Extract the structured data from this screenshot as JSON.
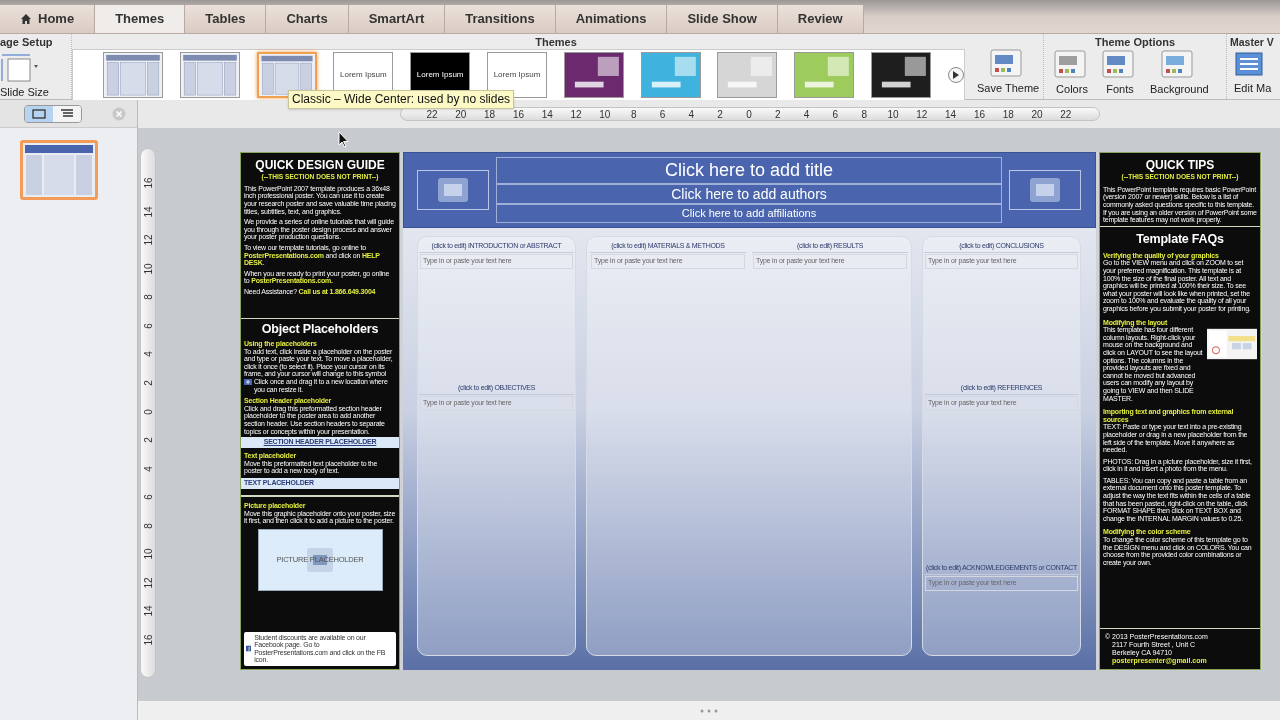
{
  "tabs": [
    {
      "label": "Home",
      "kind": "home",
      "selected": false
    },
    {
      "label": "Themes",
      "kind": "text",
      "selected": true
    },
    {
      "label": "Tables",
      "kind": "text",
      "selected": false
    },
    {
      "label": "Charts",
      "kind": "text",
      "selected": false
    },
    {
      "label": "SmartArt",
      "kind": "text",
      "selected": false
    },
    {
      "label": "Transitions",
      "kind": "text",
      "selected": false
    },
    {
      "label": "Animations",
      "kind": "text",
      "selected": false
    },
    {
      "label": "Slide Show",
      "kind": "text",
      "selected": false
    },
    {
      "label": "Review",
      "kind": "text",
      "selected": false
    }
  ],
  "ribbon": {
    "page_setup": {
      "label": "age Setup",
      "button": "Slide Size"
    },
    "themes": {
      "label": "Themes",
      "thumbnails": [
        {
          "kind": "layout",
          "selected": false
        },
        {
          "kind": "layout",
          "selected": false
        },
        {
          "kind": "layout",
          "selected": true
        },
        {
          "kind": "text",
          "label": "Lorem Ipsum",
          "dark": false,
          "selected": false
        },
        {
          "kind": "text",
          "label": "Lorem Ipsum",
          "dark": true,
          "selected": false
        },
        {
          "kind": "text",
          "label": "Lorem Ipsum",
          "dark": false,
          "selected": false
        },
        {
          "kind": "design",
          "color": "#6b2a6e",
          "selected": false
        },
        {
          "kind": "design",
          "color": "#3fb3dd",
          "selected": false
        },
        {
          "kind": "design",
          "color": "#d6d6d6",
          "selected": false
        },
        {
          "kind": "design",
          "color": "#9dcc5c",
          "selected": false
        },
        {
          "kind": "design",
          "color": "#1e1e1e",
          "selected": false
        }
      ],
      "save": "Save Theme"
    },
    "theme_options": {
      "label": "Theme Options",
      "buttons": [
        "Colors",
        "Fonts",
        "Background"
      ]
    },
    "master_views": {
      "label": "Master V",
      "button": "Edit Ma"
    }
  },
  "tooltip": "Classic – Wide Center: used by no slides",
  "view_modes": [
    {
      "kind": "slides",
      "selected": true
    },
    {
      "kind": "outline",
      "selected": false
    }
  ],
  "slide_thumbnails": [
    {
      "selected": true
    }
  ],
  "ruler_h": [
    "22",
    "20",
    "18",
    "16",
    "14",
    "12",
    "10",
    "8",
    "6",
    "4",
    "2",
    "0",
    "2",
    "4",
    "6",
    "8",
    "10",
    "12",
    "14",
    "16",
    "18",
    "20",
    "22"
  ],
  "ruler_v": [
    "16",
    "14",
    "12",
    "10",
    "8",
    "6",
    "4",
    "2",
    "0",
    "2",
    "4",
    "6",
    "8",
    "10",
    "12",
    "14",
    "16"
  ],
  "guide": {
    "title": "QUICK DESIGN GUIDE",
    "subtitle": "(--THIS SECTION DOES NOT PRINT--)",
    "paragraphs": [
      "This PowerPoint 2007 template produces a 36x48 inch professional  poster. You can use it to create your research poster and save valuable time placing titles, subtitles, text, and graphics.",
      "We provide a series of online tutorials that will guide you through the poster design process and answer your poster production questions.",
      "To view our template tutorials, go online to **PosterPresentations.com** and click on **HELP DESK**.",
      "When you are ready to  print your poster, go online to **PosterPresentations.com.**",
      "Need Assistance?  **Call  us at 1.866.649.3004**"
    ],
    "placeholders_title": "Object Placeholders",
    "placeholders": [
      {
        "kind": "cursor",
        "heading": "Using the placeholders",
        "text": "To add text, click inside a placeholder on the poster and type or paste your text.  To move a placeholder, click it once (to select it).  Place your cursor on its frame, and your cursor will change to this symbol",
        "text_after": "Click once and drag it to a new location where you can resize it."
      },
      {
        "kind": "header_sample",
        "heading": "Section Header placeholder",
        "text": "Click and drag this preformatted section header placeholder to the poster area to add another section header. Use section headers to separate topics or concepts within your presentation.",
        "sample": "SECTION HEADER PLACEHOLDER"
      },
      {
        "kind": "text_sample",
        "heading": "Text placeholder",
        "text": "Move this preformatted text placeholder to the poster to add a new body of text.",
        "sample": "TEXT PLACEHOLDER"
      },
      {
        "kind": "picture_sample",
        "heading": "Picture placeholder",
        "text": "Move this graphic placeholder onto your poster, size it first, and then click it to add a picture to the poster.",
        "sample": "PICTURE PLACEHOLDER"
      }
    ],
    "footer": "Student discounts are available on our Facebook page. Go to PosterPresentations.com and click on the FB icon."
  },
  "poster": {
    "title": "Click here to add title",
    "authors": "Click here to add authors",
    "affiliations": "Click here to add affiliations",
    "columns": [
      {
        "kind": "stack",
        "sections": [
          {
            "header": "(click to edit) INTRODUCTION or ABSTRACT",
            "placeholder": "Type in or paste your text here"
          },
          {
            "header": "(click to edit)  OBJECTIVES",
            "placeholder": "Type in or paste your text here"
          }
        ]
      },
      {
        "kind": "split",
        "sections": [
          {
            "header": "(click to edit)  MATERIALS & METHODS",
            "placeholder": "Type in or paste your text here"
          },
          {
            "header": "(click to edit)  RESULTS",
            "placeholder": "Type in or paste your text here"
          }
        ]
      },
      {
        "kind": "stack",
        "sections": [
          {
            "header": "(click to edit)  CONCLUSIONS",
            "placeholder": "Type in or paste your text here"
          },
          {
            "header": "(click to edit)  REFERENCES",
            "placeholder": "Type in or paste your text here"
          },
          {
            "header": "(click to edit)  ACKNOWLEDGEMENTS or  CONTACT",
            "placeholder": "Type in or paste your text here"
          }
        ]
      }
    ]
  },
  "tips": {
    "title": "QUICK TIPS",
    "subtitle": "(--THIS SECTION DOES NOT PRINT--)",
    "intro": "This PowerPoint template requires basic PowerPoint (version 2007 or newer) skills. Below is a list of commonly asked questions specific to this template. If you are using an older version of PowerPoint some template features may not work properly.",
    "faq_title": "Template FAQs",
    "faqs": [
      {
        "kind": "text",
        "heading": "Verifying the quality of your graphics",
        "paragraphs": [
          "Go to the VIEW menu and click on ZOOM to set your preferred magnification. This template is at 100% the size of the final poster. All text and graphics will be printed at 100% their size. To see what your poster will look like when printed, set the zoom to 100% and evaluate the quality of all your graphics before you submit your poster for printing."
        ]
      },
      {
        "kind": "picture",
        "heading": "Modifying the layout",
        "paragraphs": [
          "This template has four different column layouts.   Right-click your mouse on the background and click on LAYOUT to see the  layout options.  The columns in the provided layouts are fixed and cannot be moved but advanced users can modify any layout by going to VIEW and then SLIDE MASTER."
        ]
      },
      {
        "kind": "text",
        "heading": "Importing text and graphics from external sources",
        "paragraphs": [
          "TEXT: Paste or type your text into a pre-existing placeholder or drag in a new placeholder from the left side of the template. Move it anywhere as needed.",
          "PHOTOS: Drag in a picture placeholder, size it first, click in it and insert a photo from the menu.",
          "TABLES: You can copy and paste a table from an external document onto this poster template. To adjust the way the text fits within the cells of a table that has been pasted, right-click on the table, click FORMAT SHAPE  then click on TEXT BOX and change the INTERNAL MARGIN values to 0.25."
        ]
      },
      {
        "kind": "text",
        "heading": "Modifying the color scheme",
        "paragraphs": [
          "To change the color scheme of this template go to the DESIGN menu and click on COLORS. You can choose from the provided color combinations or create your own."
        ]
      }
    ],
    "footer": [
      "© 2013 PosterPresentations.com",
      "2117 Fourth Street , Unit C",
      "Berkeley CA 94710",
      "posterpresenter@gmail.com"
    ]
  }
}
